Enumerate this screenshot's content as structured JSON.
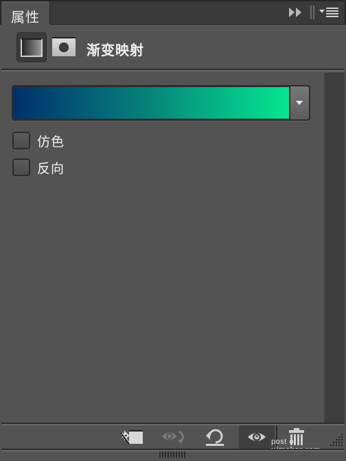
{
  "panel": {
    "tab_label": "属性",
    "title": "渐变映射",
    "icons": {
      "forward": "double-chevron-right-icon",
      "menu": "panel-menu-icon",
      "adjustment_thumb": "gradient-map-thumbnail-icon",
      "mask_thumb": "layer-mask-icon"
    }
  },
  "gradient": {
    "colors": [
      "#00306a",
      "#035b76",
      "#07857a",
      "#04b786",
      "#05e690"
    ],
    "dropdown_icon": "chevron-down-icon"
  },
  "options": [
    {
      "label": "仿色",
      "checked": false
    },
    {
      "label": "反向",
      "checked": false
    }
  ],
  "toolbar": {
    "buttons": [
      {
        "name": "clip-to-layer",
        "icon": "clip-layer-icon"
      },
      {
        "name": "view-previous-state",
        "icon": "eye-reset-icon"
      },
      {
        "name": "reset-to-defaults",
        "icon": "undo-icon"
      },
      {
        "name": "toggle-visibility",
        "icon": "eye-icon",
        "active": true
      },
      {
        "name": "delete-layer",
        "icon": "trash-icon"
      }
    ]
  },
  "watermark": {
    "prefix": "post of ",
    "brand": "uimaker",
    "suffix": ".com"
  }
}
